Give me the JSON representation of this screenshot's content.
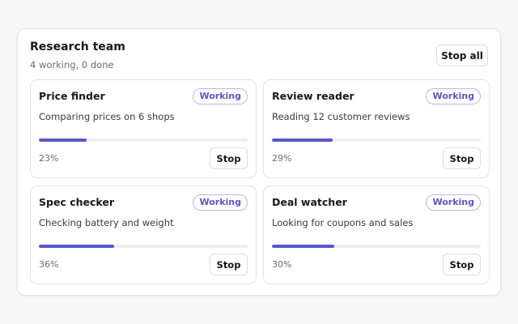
{
  "team": {
    "title": "Research team",
    "summary": "4 working, 0 done",
    "stop_all_label": "Stop all"
  },
  "agents": [
    {
      "name": "Price finder",
      "status": "Working",
      "task": "Comparing prices on 6 shops",
      "progress": 23,
      "progress_label": "23%",
      "stop_label": "Stop"
    },
    {
      "name": "Review reader",
      "status": "Working",
      "task": "Reading 12 customer reviews",
      "progress": 29,
      "progress_label": "29%",
      "stop_label": "Stop"
    },
    {
      "name": "Spec checker",
      "status": "Working",
      "task": "Checking battery and weight",
      "progress": 36,
      "progress_label": "36%",
      "stop_label": "Stop"
    },
    {
      "name": "Deal watcher",
      "status": "Working",
      "task": "Looking for coupons and sales",
      "progress": 30,
      "progress_label": "30%",
      "stop_label": "Stop"
    }
  ],
  "colors": {
    "accent": "#5b57c8",
    "badge_border": "#b9b6ea",
    "track": "#efeff1"
  }
}
